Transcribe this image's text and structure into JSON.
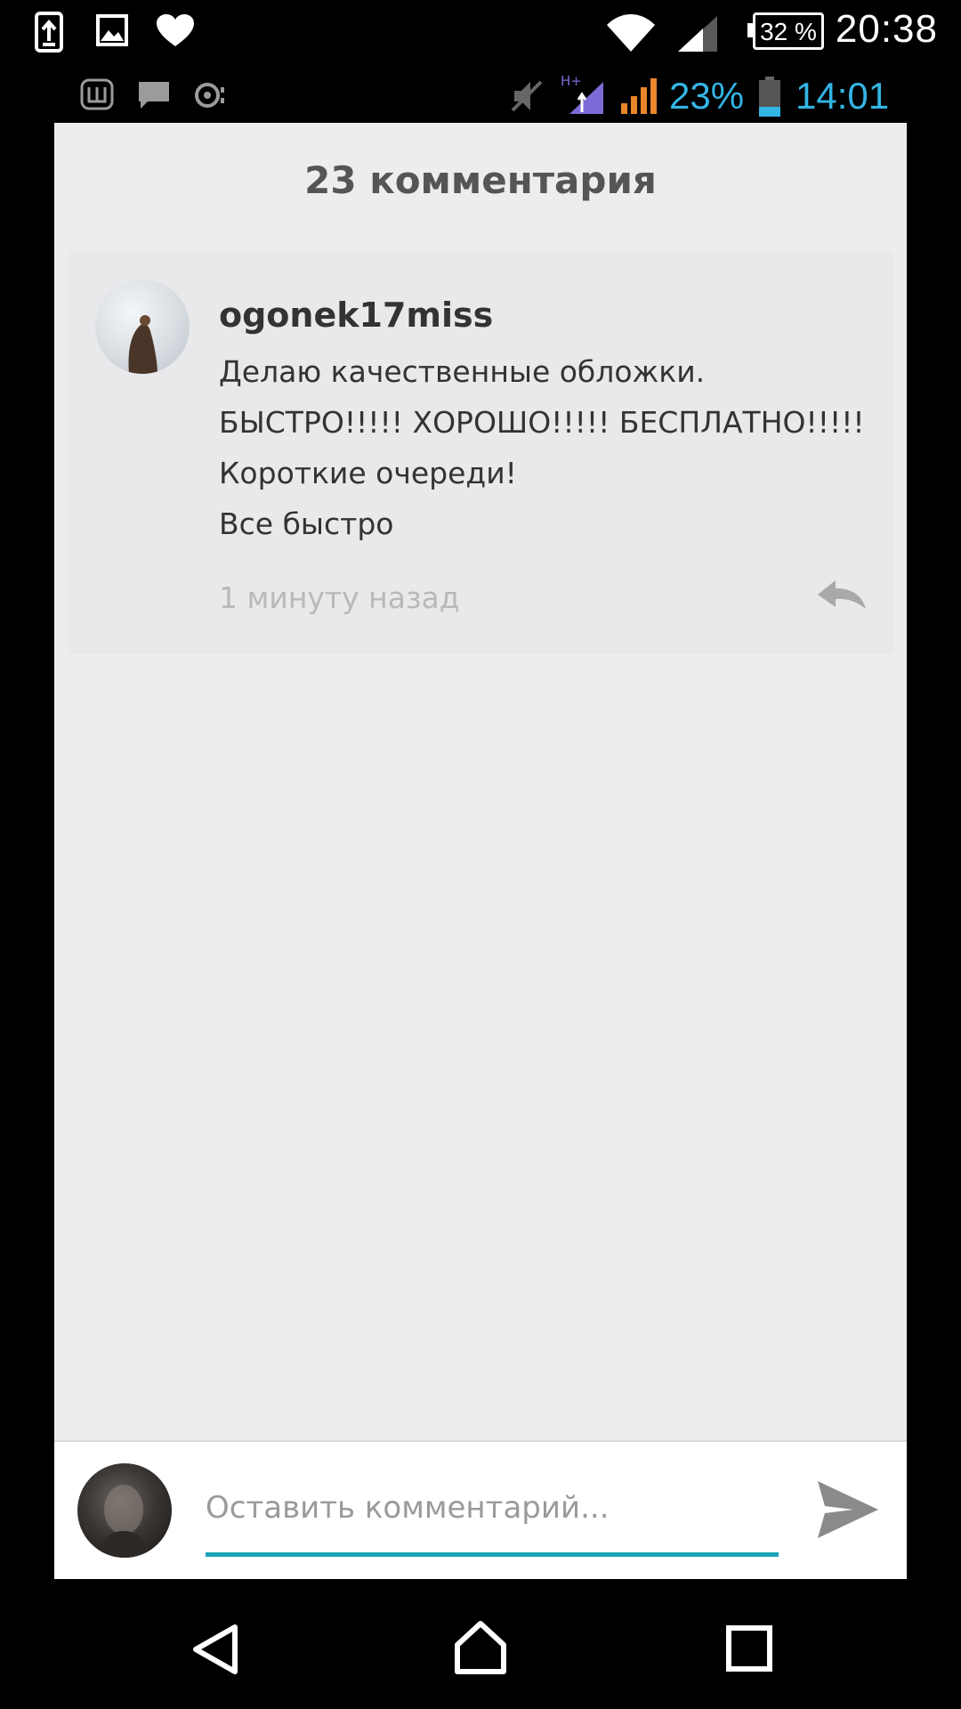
{
  "outer_status": {
    "battery": "32 %",
    "time": "20:38"
  },
  "inner_status": {
    "battery": "23%",
    "time": "14:01",
    "network_type": "H+"
  },
  "comments": {
    "title": "23 комментария",
    "items": [
      {
        "username": "ogonek17miss",
        "lines": [
          "Делаю качественные обложки.",
          "БЫСТРО!!!!! ХОРОШО!!!!! БЕСПЛАТНО!!!!!",
          "Короткие очереди!",
          "Все быстро"
        ],
        "time": "1 минуту назад"
      }
    ]
  },
  "input": {
    "placeholder": "Оставить комментарий..."
  },
  "colors": {
    "accent": "#1ba3b5",
    "status_blue": "#33b5e5",
    "app_background": "#ededef"
  },
  "icons": [
    "usb-upload-icon",
    "gallery-icon",
    "heart-icon",
    "wifi-icon",
    "signal-icon",
    "battery-icon",
    "reply-icon",
    "send-icon",
    "back-icon",
    "home-icon",
    "recents-icon"
  ]
}
